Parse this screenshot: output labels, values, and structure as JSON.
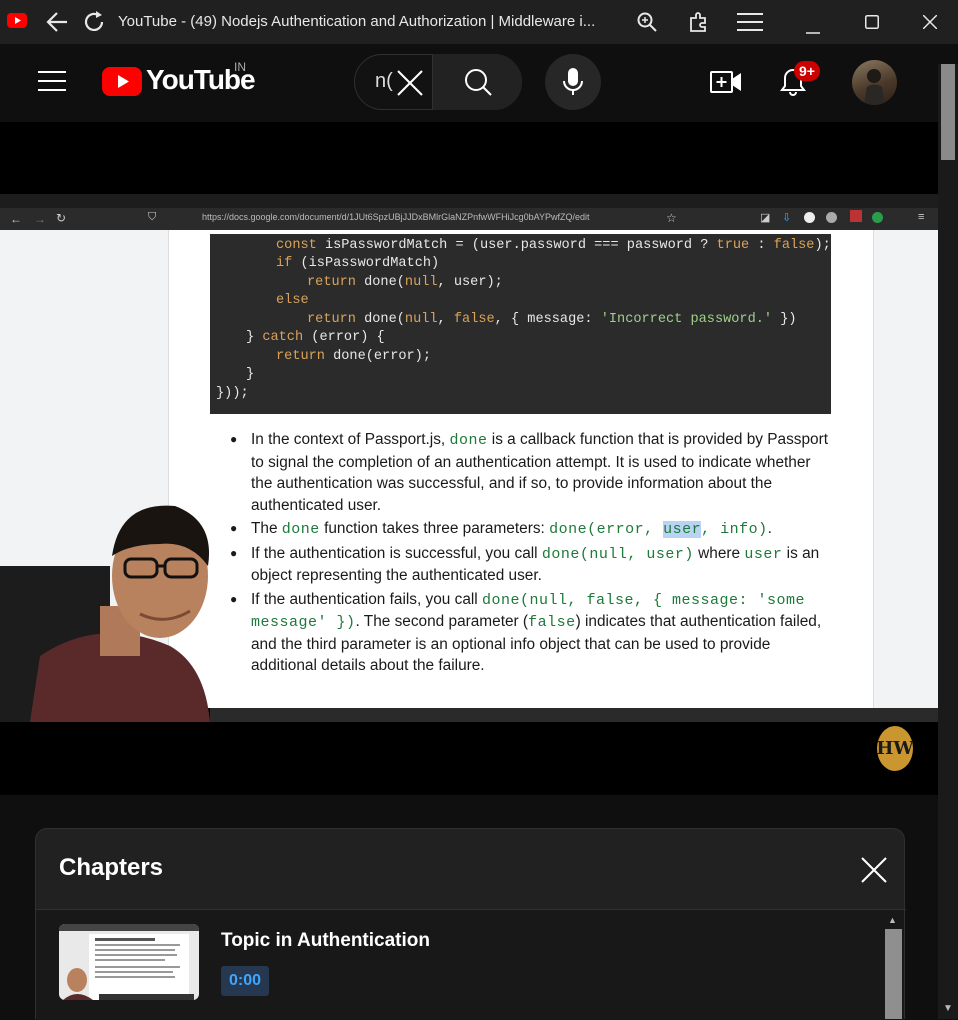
{
  "window": {
    "title": "YouTube - (49) Nodejs Authentication and Authorization | Middleware i..."
  },
  "header": {
    "logo_text": "YouTube",
    "country_code": "IN",
    "search_value": "n(",
    "notifications_count": "9+"
  },
  "video": {
    "browser_url": "https://docs.google.com/document/d/1JUt6SpzUBjJJDxBMlrGlaNZPnfwWFHiJcg0bAYPwfZQ/edit",
    "code_lines": [
      "const isPasswordMatch = (user.password === password ? true : false);",
      "if (isPasswordMatch)",
      "return done(null, user);",
      "else",
      "return done(null, false, { message: 'Incorrect password.' })",
      "} catch (error) {",
      "return done(error);",
      "}",
      "}));"
    ],
    "bullets": {
      "b1_pre": "In the context of Passport.js, ",
      "b1_code": "done",
      "b1_post": " is a callback function that is provided by Passport to signal the completion of an authentication attempt. It is used to indicate whether the authentication was successful, and if so, to provide information about the authenticated user.",
      "b2_pre": "The ",
      "b2_code": "done",
      "b2_mid": " function takes three parameters: ",
      "b2_code2a": "done(error, ",
      "b2_code2b": "user",
      "b2_code2c": ", info)",
      "b2_post": ".",
      "b3_pre": "If the authentication is successful, you call ",
      "b3_code": "done(null, user)",
      "b3_mid": " where ",
      "b3_code2": "user",
      "b3_post": " is an object representing the authenticated user.",
      "b4_pre": "If the authentication fails, you call ",
      "b4_code": "done(null, false, { message: 'some message' })",
      "b4_mid": ". The second parameter (",
      "b4_code2": "false",
      "b4_post": ") indicates that authentication failed, and the third parameter is an optional info object that can be used to provide additional details about the failure."
    },
    "watermark": "HW"
  },
  "chapters": {
    "title": "Chapters",
    "items": [
      {
        "title": "Topic in Authentication",
        "time": "0:00"
      }
    ]
  },
  "colors": {
    "accent_red": "#ff0000",
    "badge_red": "#cc0000",
    "timestamp_blue": "#3ea6ff"
  }
}
